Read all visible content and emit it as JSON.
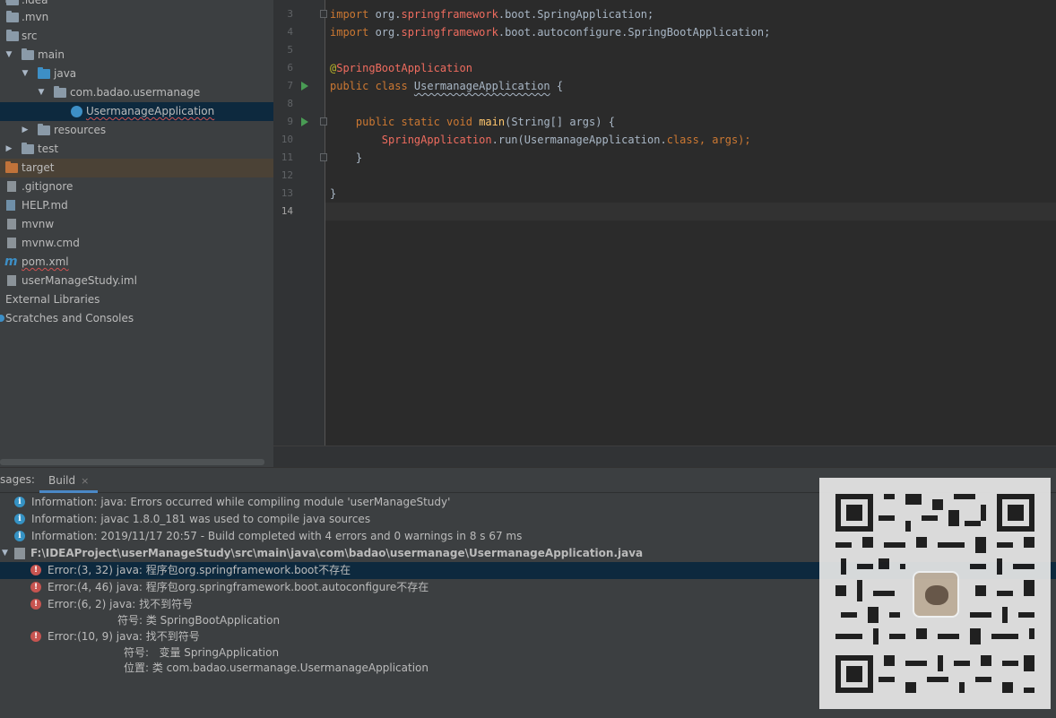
{
  "project_tree": {
    "items": [
      {
        "label": ".idea",
        "kind": "folder"
      },
      {
        "label": ".mvn",
        "kind": "folder"
      },
      {
        "label": "src",
        "kind": "folder"
      },
      {
        "label": "main",
        "kind": "folder"
      },
      {
        "label": "java",
        "kind": "source-folder"
      },
      {
        "label": "com.badao.usermanage",
        "kind": "package"
      },
      {
        "label": "UsermanageApplication",
        "kind": "class",
        "selected": true
      },
      {
        "label": "resources",
        "kind": "folder"
      },
      {
        "label": "test",
        "kind": "folder"
      },
      {
        "label": "target",
        "kind": "excluded-folder"
      },
      {
        "label": ".gitignore",
        "kind": "file"
      },
      {
        "label": "HELP.md",
        "kind": "markdown-file"
      },
      {
        "label": "mvnw",
        "kind": "file"
      },
      {
        "label": "mvnw.cmd",
        "kind": "file"
      },
      {
        "label": "pom.xml",
        "kind": "maven-file"
      },
      {
        "label": "userManageStudy.iml",
        "kind": "file"
      },
      {
        "label": "External Libraries",
        "kind": "libraries"
      },
      {
        "label": "Scratches and Consoles",
        "kind": "scratches"
      }
    ]
  },
  "editor": {
    "line_numbers": [
      "3",
      "4",
      "5",
      "6",
      "7",
      "8",
      "9",
      "10",
      "11",
      "12",
      "13",
      "14"
    ],
    "current_line": "14",
    "code": {
      "l3_import": "import ",
      "l3_pkg_a": "org.",
      "l3_pkg_err": "springframework",
      "l3_pkg_b": ".boot.SpringApplication;",
      "l4_import": "import ",
      "l4_pkg_a": "org.",
      "l4_pkg_err": "springframework",
      "l4_pkg_b": ".boot.autoconfigure.SpringBootApplication;",
      "l6_at": "@",
      "l6_ann": "SpringBootApplication",
      "l7_kw": "public class ",
      "l7_name": "UsermanageApplication",
      "l7_rest": " {",
      "l9_indent": "    ",
      "l9_kw": "public static void ",
      "l9_fn": "main",
      "l9_rest": "(String[] args) {",
      "l10_indent": "        ",
      "l10_cls": "SpringApplication",
      "l10_a": ".run(UsermanageApplication.",
      "l10_kw": "class",
      "l10_b": ", args);",
      "l11": "    }",
      "l13": "}"
    }
  },
  "messages": {
    "title": "sages:",
    "tab_label": "Build",
    "tab_close": "×",
    "rows": [
      {
        "type": "info",
        "text": "Information: java: Errors occurred while compiling module 'userManageStudy'"
      },
      {
        "type": "info",
        "text": "Information: javac 1.8.0_181 was used to compile java sources"
      },
      {
        "type": "info",
        "text": "Information: 2019/11/17 20:57 - Build completed with 4 errors and 0 warnings in 8 s 67 ms"
      },
      {
        "type": "file",
        "text": "F:\\IDEAProject\\userManageStudy\\src\\main\\java\\com\\badao\\usermanage\\UsermanageApplication.java"
      },
      {
        "type": "error",
        "text": "Error:(3, 32)  java: 程序包org.springframework.boot不存在",
        "selected": true
      },
      {
        "type": "error",
        "text": "Error:(4, 46)  java: 程序包org.springframework.boot.autoconfigure不存在"
      },
      {
        "type": "error",
        "text": "Error:(6, 2)  java: 找不到符号"
      },
      {
        "type": "detail",
        "text": "符号: 类 SpringBootApplication"
      },
      {
        "type": "error",
        "text": "Error:(10, 9)  java: 找不到符号"
      },
      {
        "type": "detail",
        "text": "符号:   变量 SpringApplication"
      },
      {
        "type": "detail",
        "text": "位置: 类 com.badao.usermanage.UsermanageApplication"
      }
    ]
  },
  "colors": {
    "background": "#2b2b2b",
    "panel": "#3c3f41",
    "selection": "#0d293e",
    "keyword": "#cc7832",
    "annotation": "#bbb529",
    "error_red": "#c75450",
    "info_blue": "#3592c4"
  }
}
